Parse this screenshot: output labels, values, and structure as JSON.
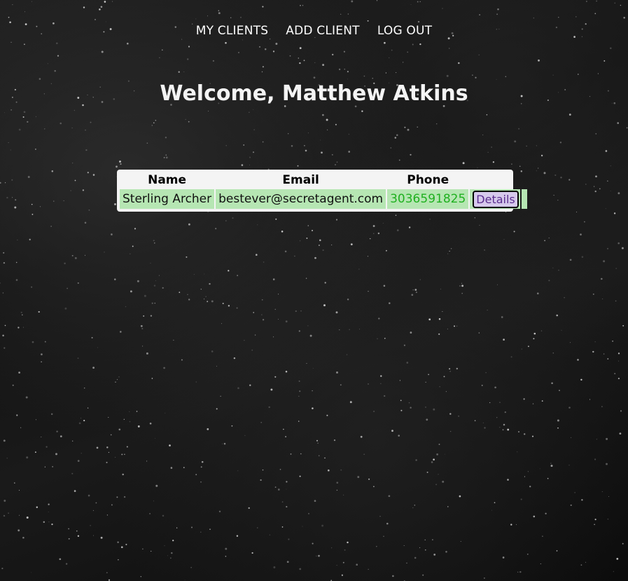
{
  "nav": {
    "items": [
      {
        "label": "MY CLIENTS"
      },
      {
        "label": "ADD CLIENT"
      },
      {
        "label": "LOG OUT"
      }
    ]
  },
  "welcome": {
    "text": "Welcome, Matthew Atkins"
  },
  "clients_table": {
    "headers": [
      "Name",
      "Email",
      "Phone"
    ],
    "rows": [
      {
        "name": "Sterling Archer",
        "email": "bestever@secretagent.com",
        "phone": "3036591825",
        "action_label": "Details"
      }
    ]
  },
  "colors": {
    "row_background": "#b6e6b3",
    "phone_text": "#1fb01f",
    "details_text": "#5a2d8e",
    "header_background": "#f4f4f4"
  }
}
